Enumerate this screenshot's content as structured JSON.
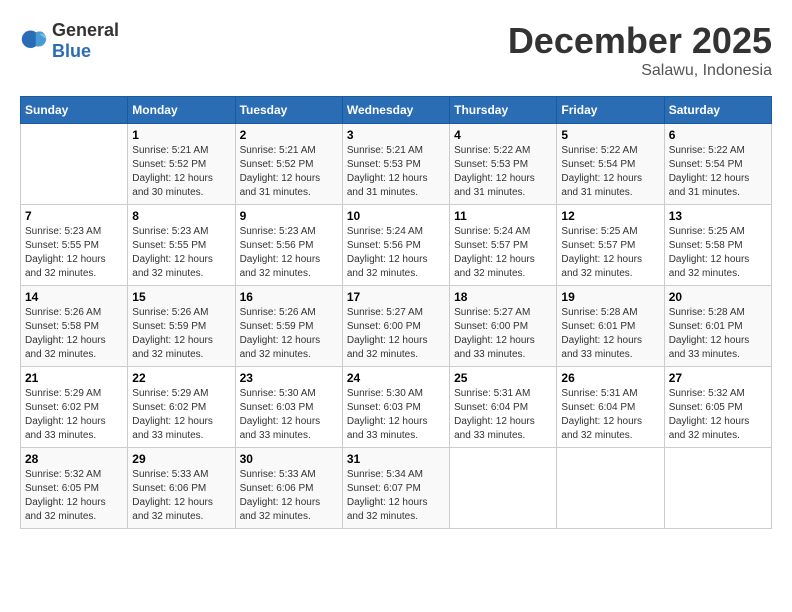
{
  "header": {
    "logo_general": "General",
    "logo_blue": "Blue",
    "month_year": "December 2025",
    "location": "Salawu, Indonesia"
  },
  "weekdays": [
    "Sunday",
    "Monday",
    "Tuesday",
    "Wednesday",
    "Thursday",
    "Friday",
    "Saturday"
  ],
  "weeks": [
    [
      {
        "day": "",
        "sunrise": "",
        "sunset": "",
        "daylight": ""
      },
      {
        "day": "1",
        "sunrise": "5:21 AM",
        "sunset": "5:52 PM",
        "daylight": "12 hours and 30 minutes."
      },
      {
        "day": "2",
        "sunrise": "5:21 AM",
        "sunset": "5:52 PM",
        "daylight": "12 hours and 31 minutes."
      },
      {
        "day": "3",
        "sunrise": "5:21 AM",
        "sunset": "5:53 PM",
        "daylight": "12 hours and 31 minutes."
      },
      {
        "day": "4",
        "sunrise": "5:22 AM",
        "sunset": "5:53 PM",
        "daylight": "12 hours and 31 minutes."
      },
      {
        "day": "5",
        "sunrise": "5:22 AM",
        "sunset": "5:54 PM",
        "daylight": "12 hours and 31 minutes."
      },
      {
        "day": "6",
        "sunrise": "5:22 AM",
        "sunset": "5:54 PM",
        "daylight": "12 hours and 31 minutes."
      }
    ],
    [
      {
        "day": "7",
        "sunrise": "5:23 AM",
        "sunset": "5:55 PM",
        "daylight": "12 hours and 32 minutes."
      },
      {
        "day": "8",
        "sunrise": "5:23 AM",
        "sunset": "5:55 PM",
        "daylight": "12 hours and 32 minutes."
      },
      {
        "day": "9",
        "sunrise": "5:23 AM",
        "sunset": "5:56 PM",
        "daylight": "12 hours and 32 minutes."
      },
      {
        "day": "10",
        "sunrise": "5:24 AM",
        "sunset": "5:56 PM",
        "daylight": "12 hours and 32 minutes."
      },
      {
        "day": "11",
        "sunrise": "5:24 AM",
        "sunset": "5:57 PM",
        "daylight": "12 hours and 32 minutes."
      },
      {
        "day": "12",
        "sunrise": "5:25 AM",
        "sunset": "5:57 PM",
        "daylight": "12 hours and 32 minutes."
      },
      {
        "day": "13",
        "sunrise": "5:25 AM",
        "sunset": "5:58 PM",
        "daylight": "12 hours and 32 minutes."
      }
    ],
    [
      {
        "day": "14",
        "sunrise": "5:26 AM",
        "sunset": "5:58 PM",
        "daylight": "12 hours and 32 minutes."
      },
      {
        "day": "15",
        "sunrise": "5:26 AM",
        "sunset": "5:59 PM",
        "daylight": "12 hours and 32 minutes."
      },
      {
        "day": "16",
        "sunrise": "5:26 AM",
        "sunset": "5:59 PM",
        "daylight": "12 hours and 32 minutes."
      },
      {
        "day": "17",
        "sunrise": "5:27 AM",
        "sunset": "6:00 PM",
        "daylight": "12 hours and 32 minutes."
      },
      {
        "day": "18",
        "sunrise": "5:27 AM",
        "sunset": "6:00 PM",
        "daylight": "12 hours and 33 minutes."
      },
      {
        "day": "19",
        "sunrise": "5:28 AM",
        "sunset": "6:01 PM",
        "daylight": "12 hours and 33 minutes."
      },
      {
        "day": "20",
        "sunrise": "5:28 AM",
        "sunset": "6:01 PM",
        "daylight": "12 hours and 33 minutes."
      }
    ],
    [
      {
        "day": "21",
        "sunrise": "5:29 AM",
        "sunset": "6:02 PM",
        "daylight": "12 hours and 33 minutes."
      },
      {
        "day": "22",
        "sunrise": "5:29 AM",
        "sunset": "6:02 PM",
        "daylight": "12 hours and 33 minutes."
      },
      {
        "day": "23",
        "sunrise": "5:30 AM",
        "sunset": "6:03 PM",
        "daylight": "12 hours and 33 minutes."
      },
      {
        "day": "24",
        "sunrise": "5:30 AM",
        "sunset": "6:03 PM",
        "daylight": "12 hours and 33 minutes."
      },
      {
        "day": "25",
        "sunrise": "5:31 AM",
        "sunset": "6:04 PM",
        "daylight": "12 hours and 33 minutes."
      },
      {
        "day": "26",
        "sunrise": "5:31 AM",
        "sunset": "6:04 PM",
        "daylight": "12 hours and 32 minutes."
      },
      {
        "day": "27",
        "sunrise": "5:32 AM",
        "sunset": "6:05 PM",
        "daylight": "12 hours and 32 minutes."
      }
    ],
    [
      {
        "day": "28",
        "sunrise": "5:32 AM",
        "sunset": "6:05 PM",
        "daylight": "12 hours and 32 minutes."
      },
      {
        "day": "29",
        "sunrise": "5:33 AM",
        "sunset": "6:06 PM",
        "daylight": "12 hours and 32 minutes."
      },
      {
        "day": "30",
        "sunrise": "5:33 AM",
        "sunset": "6:06 PM",
        "daylight": "12 hours and 32 minutes."
      },
      {
        "day": "31",
        "sunrise": "5:34 AM",
        "sunset": "6:07 PM",
        "daylight": "12 hours and 32 minutes."
      },
      {
        "day": "",
        "sunrise": "",
        "sunset": "",
        "daylight": ""
      },
      {
        "day": "",
        "sunrise": "",
        "sunset": "",
        "daylight": ""
      },
      {
        "day": "",
        "sunrise": "",
        "sunset": "",
        "daylight": ""
      }
    ]
  ]
}
